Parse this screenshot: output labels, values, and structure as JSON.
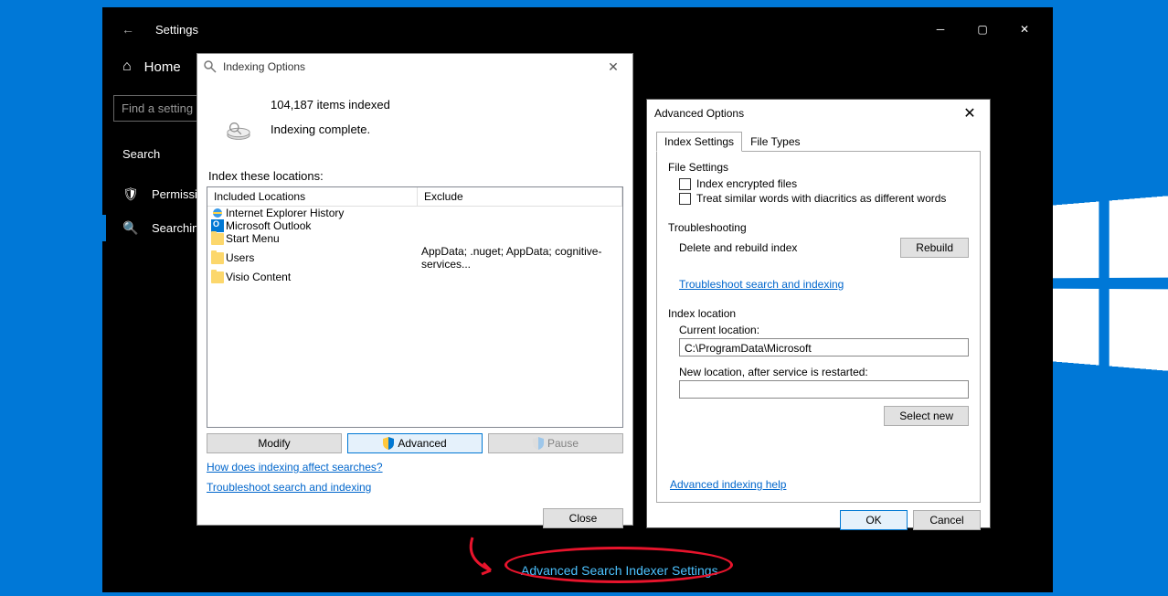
{
  "settings": {
    "title": "Settings",
    "home_label": "Home",
    "search_placeholder": "Find a setting",
    "section_heading": "Search",
    "nav": {
      "permissions": "Permissions & History",
      "searching": "Searching Windows"
    },
    "content_link": "Advanced Search Indexer Settings"
  },
  "indexing": {
    "title": "Indexing Options",
    "items_indexed": "104,187 items indexed",
    "status": "Indexing complete.",
    "locations_label": "Index these locations:",
    "col_included": "Included Locations",
    "col_exclude": "Exclude",
    "rows": [
      {
        "name": "Internet Explorer History",
        "icon": "ie",
        "exclude": ""
      },
      {
        "name": "Microsoft Outlook",
        "icon": "outlook",
        "exclude": ""
      },
      {
        "name": "Start Menu",
        "icon": "folder",
        "exclude": ""
      },
      {
        "name": "Users",
        "icon": "folder",
        "exclude": "AppData; .nuget; AppData; cognitive-services..."
      },
      {
        "name": "Visio Content",
        "icon": "folder",
        "exclude": ""
      }
    ],
    "btn_modify": "Modify",
    "btn_advanced": "Advanced",
    "btn_pause": "Pause",
    "link_how": "How does indexing affect searches?",
    "link_trouble": "Troubleshoot search and indexing",
    "btn_close": "Close"
  },
  "advanced": {
    "title": "Advanced Options",
    "tab_index": "Index Settings",
    "tab_filetypes": "File Types",
    "file_settings_label": "File Settings",
    "cb_encrypted": "Index encrypted files",
    "cb_diacritics": "Treat similar words with diacritics as different words",
    "troubleshooting_label": "Troubleshooting",
    "delete_rebuild": "Delete and rebuild index",
    "btn_rebuild": "Rebuild",
    "link_trouble": "Troubleshoot search and indexing",
    "index_location_label": "Index location",
    "current_location_label": "Current location:",
    "current_location": "C:\\ProgramData\\Microsoft",
    "new_location_label": "New location, after service is restarted:",
    "btn_select_new": "Select new",
    "link_help": "Advanced indexing help",
    "btn_ok": "OK",
    "btn_cancel": "Cancel"
  }
}
